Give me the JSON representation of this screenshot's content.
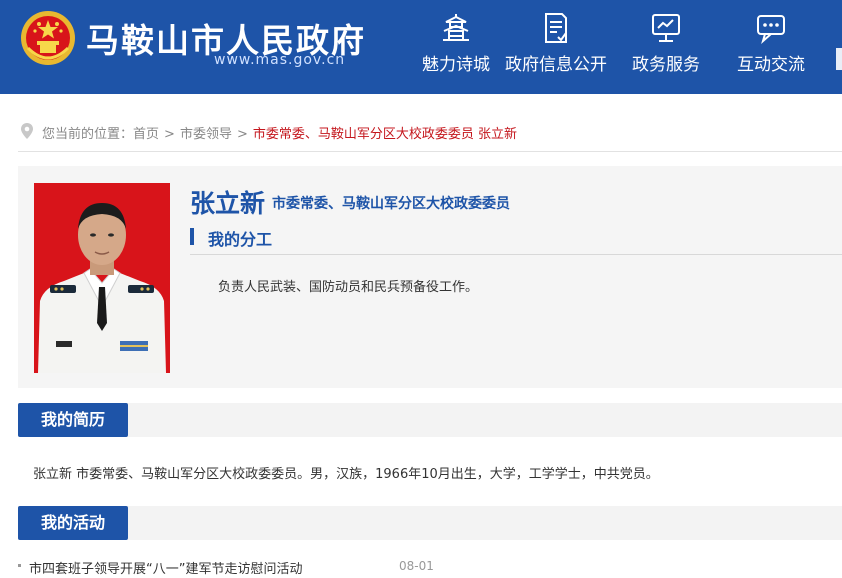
{
  "header": {
    "site_title": "马鞍山市人民政府",
    "site_url": "www.mas.gov.cn",
    "nav": [
      {
        "label": "魅力诗城",
        "icon": "pagoda-icon"
      },
      {
        "label": "政府信息公开",
        "icon": "document-icon"
      },
      {
        "label": "政务服务",
        "icon": "monitor-icon"
      },
      {
        "label": "互动交流",
        "icon": "chat-bubble-icon"
      }
    ]
  },
  "breadcrumb": {
    "prefix": "您当前的位置：",
    "home": "首页",
    "section": "市委领导",
    "current": "市委常委、马鞍山军分区大校政委委员 张立新"
  },
  "profile": {
    "name": "张立新",
    "position": "市委常委、马鞍山军分区大校政委委员",
    "duty_heading": "我的分工",
    "duty_text": "负责人民武装、国防动员和民兵预备役工作。"
  },
  "resume": {
    "heading": "我的简历",
    "text": "张立新 市委常委、马鞍山军分区大校政委委员。男，汉族，1966年10月出生，大学，工学学士，中共党员。"
  },
  "activities": {
    "heading": "我的活动",
    "items": [
      {
        "title": "市四套班子领导开展“八一”建军节走访慰问活动",
        "date": "08-01"
      }
    ]
  },
  "colors": {
    "brand_blue": "#1e54a8",
    "accent_red": "#c4161c"
  }
}
